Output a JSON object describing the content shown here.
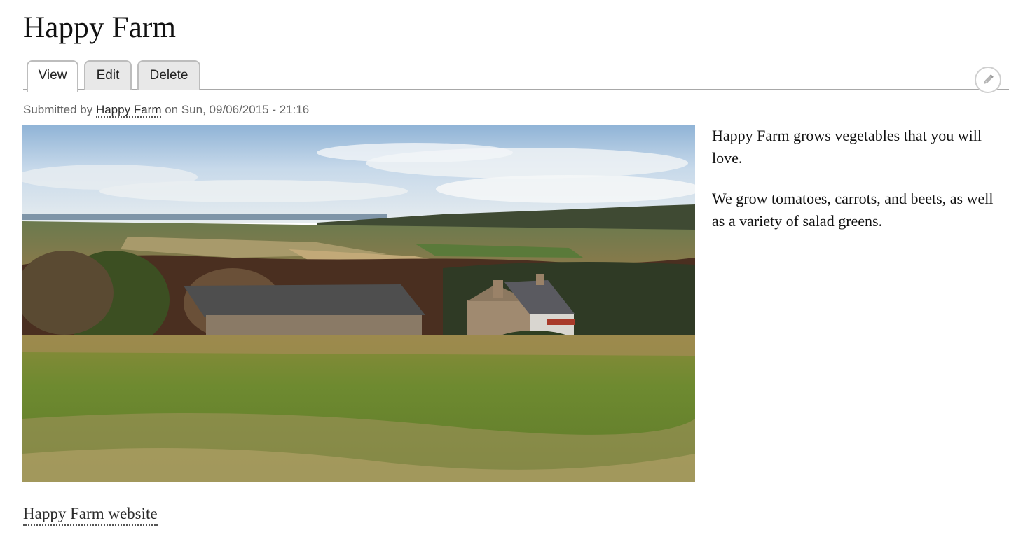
{
  "page": {
    "title": "Happy Farm"
  },
  "tabs": {
    "view": "View",
    "edit": "Edit",
    "delete": "Delete"
  },
  "meta": {
    "prefix": "Submitted by ",
    "author": "Happy Farm",
    "date_text": " on Sun, 09/06/2015 - 21:16"
  },
  "body": {
    "paragraphs": [
      "Happy Farm grows vegetables that you will love.",
      "We grow tomatoes, carrots, and beets, as well as a variety of salad greens."
    ]
  },
  "links": {
    "website": "Happy Farm website"
  },
  "icons": {
    "edit": "pencil-icon"
  },
  "colors": {
    "tab_border": "#bdbdbd",
    "tab_inactive_bg": "#e8e8e8",
    "meta_text": "#666666"
  }
}
